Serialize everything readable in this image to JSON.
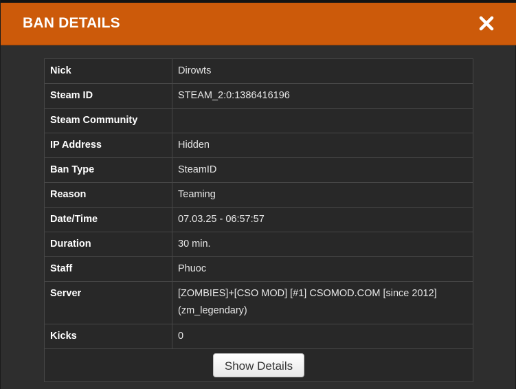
{
  "modal": {
    "title": "BAN DETAILS",
    "close_icon": "close-icon",
    "accent_color": "#cc5a0a"
  },
  "details": {
    "rows": [
      {
        "label": "Nick",
        "value": "Dirowts"
      },
      {
        "label": "Steam ID",
        "value": "STEAM_2:0:1386416196"
      },
      {
        "label": "Steam Community",
        "value": ""
      },
      {
        "label": "IP Address",
        "value": "Hidden"
      },
      {
        "label": "Ban Type",
        "value": "SteamID"
      },
      {
        "label": "Reason",
        "value": "Teaming"
      },
      {
        "label": "Date/Time",
        "value": "07.03.25 - 06:57:57"
      },
      {
        "label": "Duration",
        "value": "30 min."
      },
      {
        "label": "Staff",
        "value": "Phuoc"
      },
      {
        "label": "Server",
        "value": "[ZOMBIES]+[CSO MOD] [#1] CSOMOD.COM [since 2012] (zm_legendary)"
      },
      {
        "label": "Kicks",
        "value": "0"
      }
    ],
    "show_details_label": "Show Details"
  }
}
